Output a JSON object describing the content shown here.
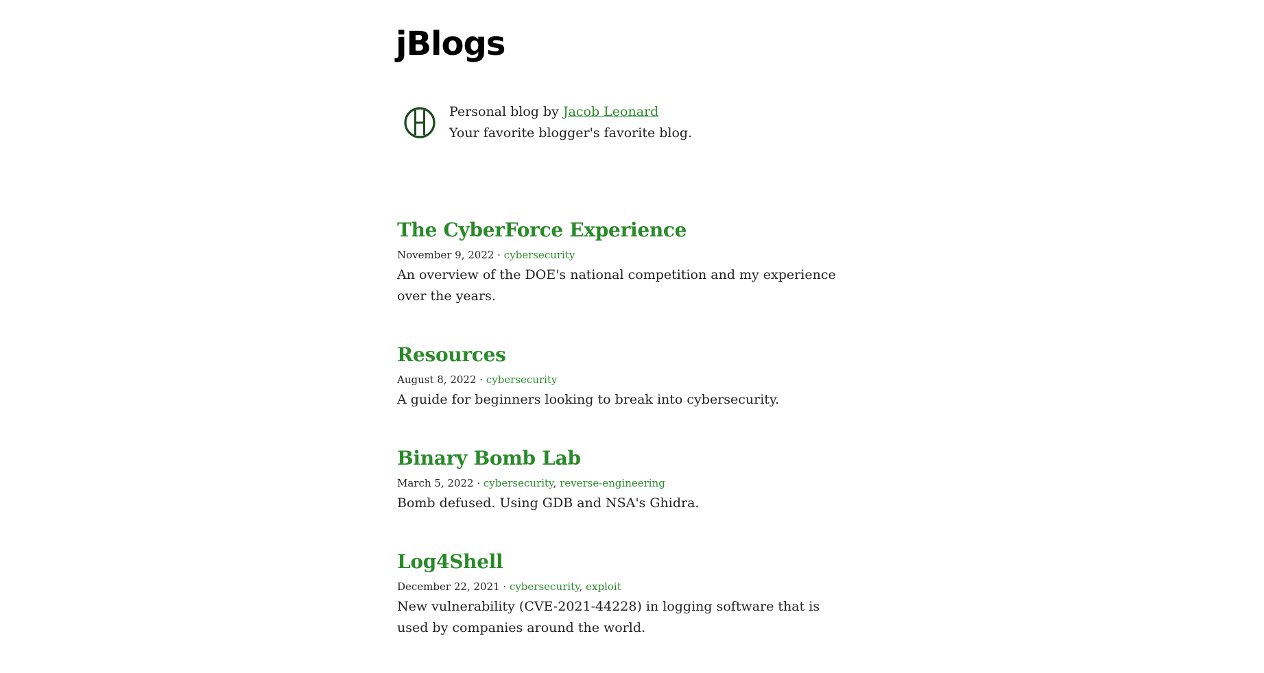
{
  "header": {
    "title": "jBlogs"
  },
  "bio": {
    "prefix": "Personal blog by ",
    "author": "Jacob Leonard",
    "tagline": "Your favorite blogger's favorite blog."
  },
  "posts": [
    {
      "title": "The CyberForce Experience",
      "date": "November 9, 2022",
      "tags": [
        "cybersecurity"
      ],
      "description": "An overview of the DOE's national competition and my experience over the years."
    },
    {
      "title": "Resources",
      "date": "August 8, 2022",
      "tags": [
        "cybersecurity"
      ],
      "description": "A guide for beginners looking to break into cybersecurity."
    },
    {
      "title": "Binary Bomb Lab",
      "date": "March 5, 2022",
      "tags": [
        "cybersecurity",
        "reverse-engineering"
      ],
      "description": "Bomb defused. Using GDB and NSA's Ghidra."
    },
    {
      "title": "Log4Shell",
      "date": "December 22, 2021",
      "tags": [
        "cybersecurity",
        "exploit"
      ],
      "description": "New vulnerability (CVE-2021-44228) in logging software that is used by companies around the world."
    }
  ],
  "colors": {
    "accent": "#2a8a2a",
    "text": "#222222",
    "title": "#000000",
    "avatar": "#1f4a1f"
  },
  "icons": {
    "avatar": "jl-monogram-icon"
  }
}
